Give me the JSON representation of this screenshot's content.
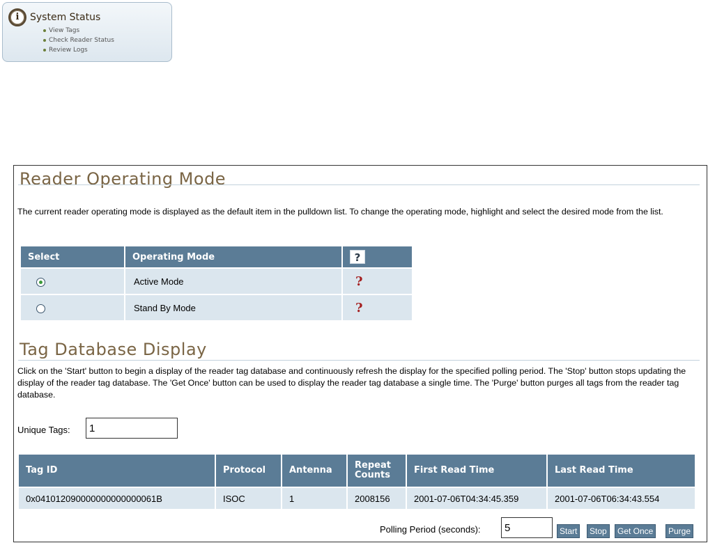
{
  "status_box": {
    "title": "System Status",
    "icon": "info-icon",
    "icon_glyph": "i",
    "links": [
      "View Tags",
      "Check Reader Status",
      "Review Logs"
    ]
  },
  "operating_mode": {
    "title": "Reader Operating Mode",
    "description": "The current reader operating mode is displayed as the default item in the pulldown list. To change the operating mode, highlight and select the desired mode from the list.",
    "headers": {
      "select": "Select",
      "mode": "Operating Mode",
      "help": "?"
    },
    "rows": [
      {
        "label": "Active Mode",
        "selected": true,
        "help": "?"
      },
      {
        "label": "Stand By Mode",
        "selected": false,
        "help": "?"
      }
    ]
  },
  "tag_database": {
    "title": "Tag Database Display",
    "description": "Click on the 'Start' button to begin a display of the reader tag database and continuously refresh the display for the specified polling period. The 'Stop' button stops updating the display of the reader tag database. The 'Get Once' button can be used to display the reader tag database a single time. The 'Purge' button purges all tags from the reader tag database.",
    "unique_tags_label": "Unique Tags:",
    "unique_tags_value": "1",
    "columns": {
      "tag_id": "Tag ID",
      "protocol": "Protocol",
      "antenna": "Antenna",
      "repeat_1": "Repeat",
      "repeat_2": "Counts",
      "first_read": "First Read Time",
      "last_read": "Last Read Time"
    },
    "rows": [
      {
        "tag_id": "0x041012090000000000000061B",
        "protocol": "ISOC",
        "antenna": "1",
        "repeat_counts": "2008156",
        "first_read": "2001-07-06T04:34:45.359",
        "last_read": "2001-07-06T06:34:43.554"
      }
    ],
    "polling_label": "Polling Period (seconds):",
    "polling_value": "5",
    "buttons": {
      "start": "Start",
      "stop": "Stop",
      "get_once": "Get Once",
      "purge": "Purge"
    }
  },
  "colors": {
    "header_bg": "#5b7c96",
    "row_bg": "#dbe6ee",
    "title_color": "#7a6545",
    "help_mark": "#a41f1f"
  }
}
